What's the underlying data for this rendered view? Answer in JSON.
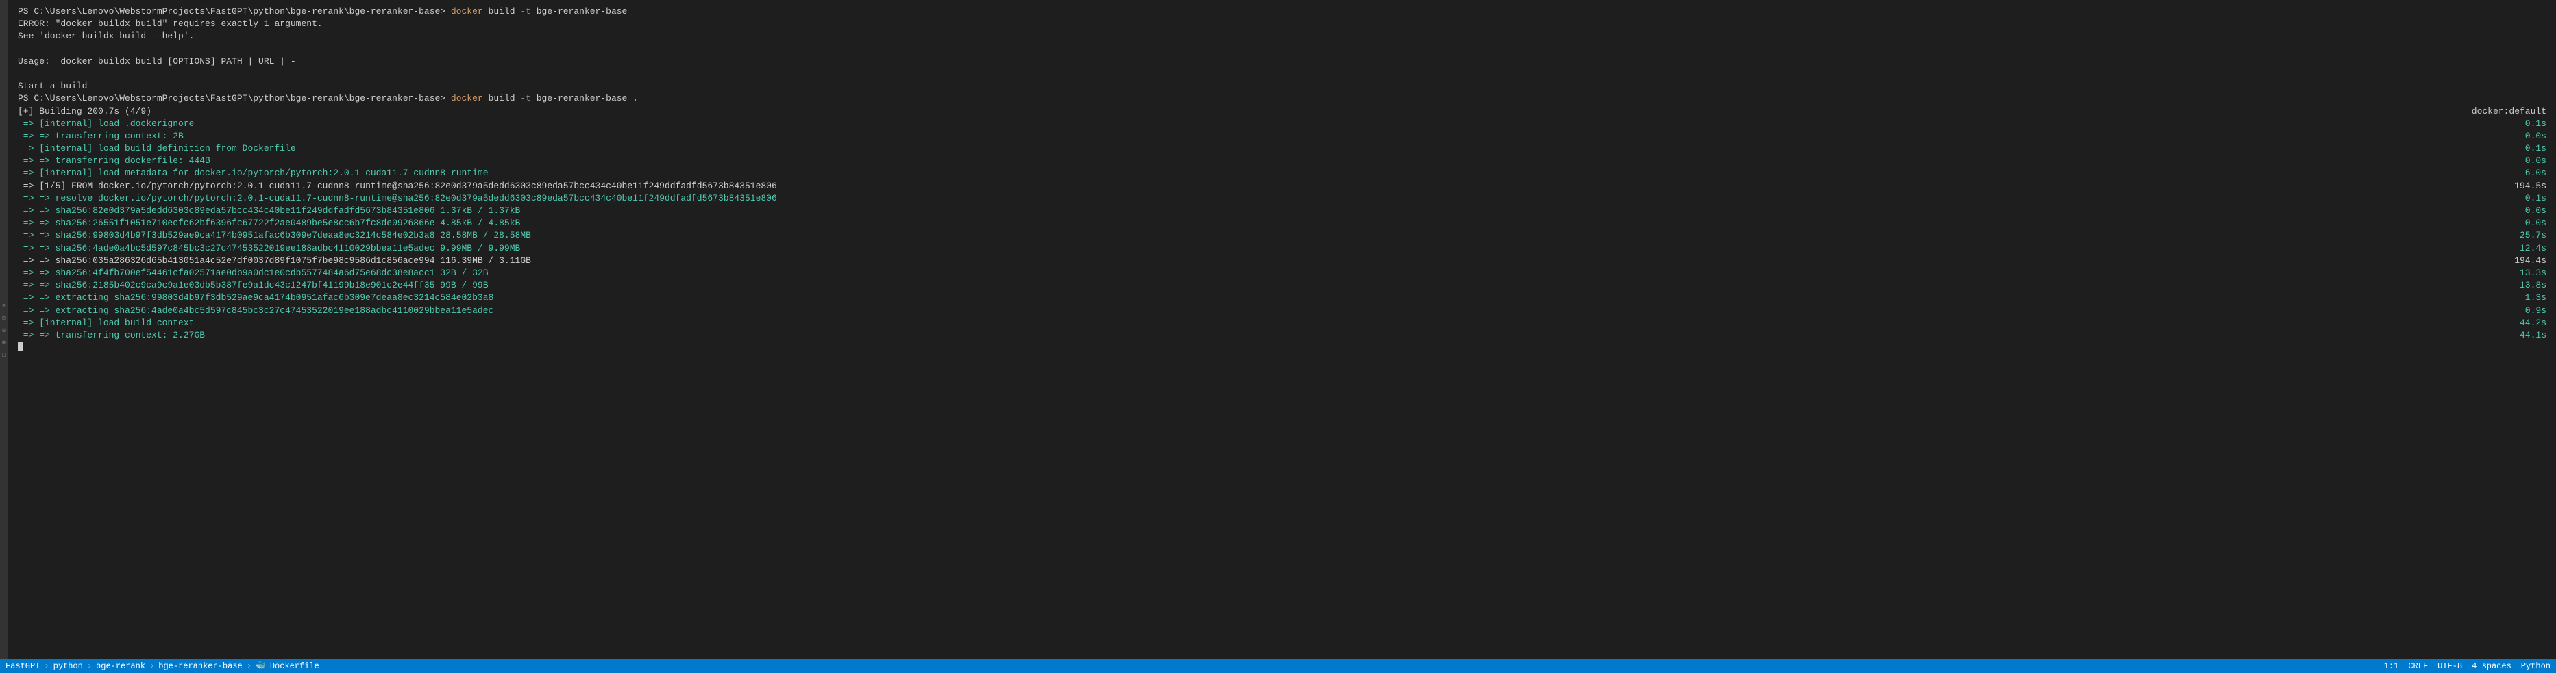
{
  "prompt1": {
    "path": "PS C:\\Users\\Lenovo\\WebstormProjects\\FastGPT\\python\\bge-rerank\\bge-reranker-base> ",
    "docker": "docker",
    "build": " build ",
    "flag": "-t",
    "rest": " bge-reranker-base"
  },
  "error1": "ERROR: \"docker buildx build\" requires exactly 1 argument.",
  "error2": "See 'docker buildx build --help'.",
  "usage": "Usage:  docker buildx build [OPTIONS] PATH | URL | -",
  "start": "Start a build",
  "prompt2": {
    "path": "PS C:\\Users\\Lenovo\\WebstormProjects\\FastGPT\\python\\bge-rerank\\bge-reranker-base> ",
    "docker": "docker",
    "build": " build ",
    "flag": "-t",
    "rest": " bge-reranker-base ."
  },
  "building_left": "[+] Building 200.7s (4/9)",
  "building_right": "docker:default",
  "lines": [
    {
      "left": " => [internal] load .dockerignore",
      "right": "0.1s",
      "color": "teal"
    },
    {
      "left": " => => transferring context: 2B",
      "right": "0.0s",
      "color": "teal"
    },
    {
      "left": " => [internal] load build definition from Dockerfile",
      "right": "0.1s",
      "color": "teal"
    },
    {
      "left": " => => transferring dockerfile: 444B",
      "right": "0.0s",
      "color": "teal"
    },
    {
      "left": " => [internal] load metadata for docker.io/pytorch/pytorch:2.0.1-cuda11.7-cudnn8-runtime",
      "right": "6.0s",
      "color": "teal"
    },
    {
      "left": " => [1/5] FROM docker.io/pytorch/pytorch:2.0.1-cuda11.7-cudnn8-runtime@sha256:82e0d379a5dedd6303c89eda57bcc434c40be11f249ddfadfd5673b84351e806",
      "right": "194.5s",
      "color": "white"
    },
    {
      "left": " => => resolve docker.io/pytorch/pytorch:2.0.1-cuda11.7-cudnn8-runtime@sha256:82e0d379a5dedd6303c89eda57bcc434c40be11f249ddfadfd5673b84351e806",
      "right": "0.1s",
      "color": "teal"
    },
    {
      "left": " => => sha256:82e0d379a5dedd6303c89eda57bcc434c40be11f249ddfadfd5673b84351e806 1.37kB / 1.37kB",
      "right": "0.0s",
      "color": "teal"
    },
    {
      "left": " => => sha256:26551f1051e710ecfc62bf6396fc67722f2ae0489be5e8cc6b7fc8de0926866e 4.85kB / 4.85kB",
      "right": "0.0s",
      "color": "teal"
    },
    {
      "left": " => => sha256:99803d4b97f3db529ae9ca4174b0951afac6b309e7deaa8ec3214c584e02b3a8 28.58MB / 28.58MB",
      "right": "25.7s",
      "color": "teal"
    },
    {
      "left": " => => sha256:4ade0a4bc5d597c845bc3c27c47453522019ee188adbc4110029bbea11e5adec 9.99MB / 9.99MB",
      "right": "12.4s",
      "color": "teal"
    },
    {
      "left": " => => sha256:035a286326d65b413051a4c52e7df0037d89f1075f7be98c9586d1c856ace994 116.39MB / 3.11GB",
      "right": "194.4s",
      "color": "white"
    },
    {
      "left": " => => sha256:4f4fb700ef54461cfa02571ae0db9a0dc1e0cdb5577484a6d75e68dc38e8acc1 32B / 32B",
      "right": "13.3s",
      "color": "teal"
    },
    {
      "left": " => => sha256:2185b402c9ca9c9a1e03db5b387fe9a1dc43c1247bf41199b18e901c2e44ff35 99B / 99B",
      "right": "13.8s",
      "color": "teal"
    },
    {
      "left": " => => extracting sha256:99803d4b97f3db529ae9ca4174b0951afac6b309e7deaa8ec3214c584e02b3a8",
      "right": "1.3s",
      "color": "teal"
    },
    {
      "left": " => => extracting sha256:4ade0a4bc5d597c845bc3c27c47453522019ee188adbc4110029bbea11e5adec",
      "right": "0.9s",
      "color": "teal"
    },
    {
      "left": " => [internal] load build context",
      "right": "44.2s",
      "color": "teal"
    },
    {
      "left": " => => transferring context: 2.27GB",
      "right": "44.1s",
      "color": "teal"
    }
  ],
  "breadcrumb": {
    "items": [
      "FastGPT",
      "python",
      "bge-rerank",
      "bge-reranker-base",
      "Dockerfile"
    ]
  },
  "status": {
    "position": "1:1",
    "eol": "CRLF",
    "encoding": "UTF-8",
    "indent": "4 spaces",
    "lang": "Python"
  }
}
